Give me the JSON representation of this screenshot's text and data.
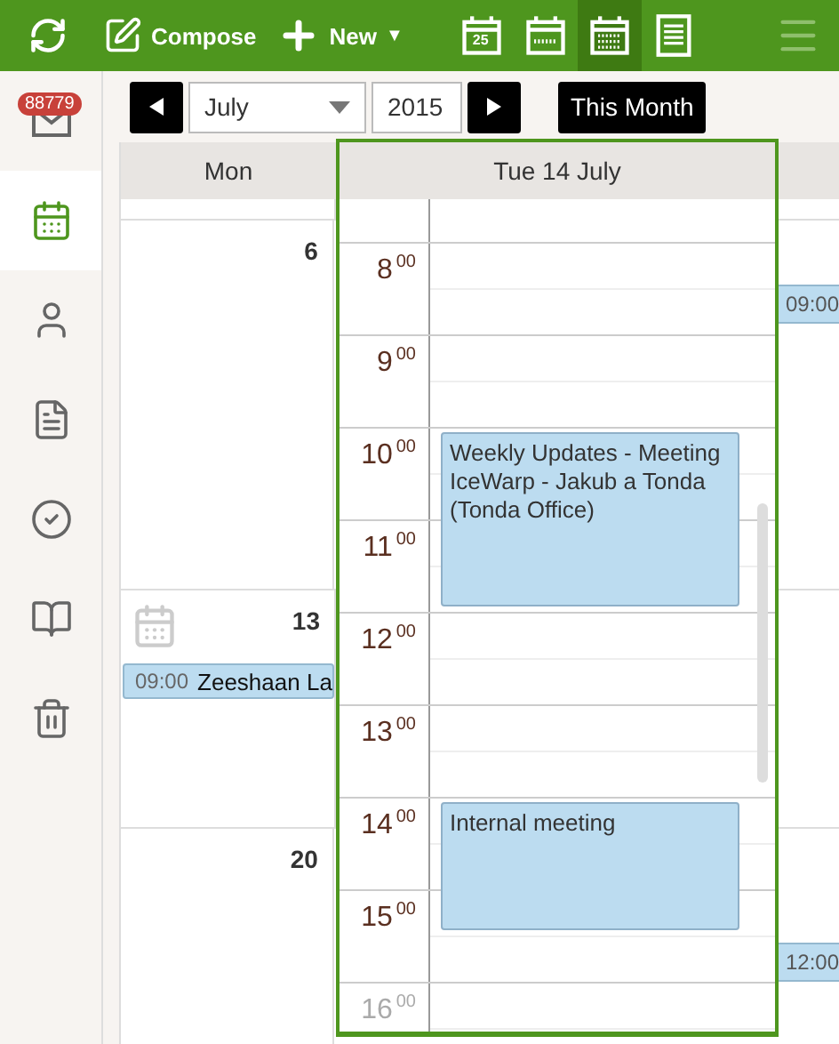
{
  "toolbar": {
    "compose": "Compose",
    "new": "New",
    "caret": "▼",
    "views": [
      {
        "kind": "day",
        "label": "25",
        "selected": false
      },
      {
        "kind": "week",
        "selected": false
      },
      {
        "kind": "month",
        "selected": true
      },
      {
        "kind": "list",
        "selected": false
      }
    ]
  },
  "sidebar": {
    "items": [
      {
        "kind": "mail",
        "badge": "88779",
        "selected": false
      },
      {
        "kind": "calendar",
        "selected": true
      },
      {
        "kind": "contacts",
        "selected": false
      },
      {
        "kind": "notes",
        "selected": false
      },
      {
        "kind": "tasks",
        "selected": false
      },
      {
        "kind": "journal",
        "selected": false
      },
      {
        "kind": "trash",
        "selected": false
      }
    ]
  },
  "navigation": {
    "month": "July",
    "year": "2015",
    "today": "This Month"
  },
  "month_grid": {
    "column": "Mon",
    "weeks": [
      {
        "date": "6",
        "side_events": [
          {
            "time": "09:00"
          }
        ]
      },
      {
        "date": "13",
        "today_icon": true,
        "events": [
          {
            "time": "09:00",
            "title": "Zeeshaan La"
          }
        ]
      },
      {
        "date": "20",
        "side_events": [
          {
            "time": "12:00"
          }
        ]
      }
    ]
  },
  "day_popup": {
    "title": "Tue 14 July",
    "hours": [
      {
        "hour": "8",
        "minutes": "00",
        "dimmed": false
      },
      {
        "hour": "9",
        "minutes": "00",
        "dimmed": false
      },
      {
        "hour": "10",
        "minutes": "00",
        "dimmed": false,
        "events": [
          {
            "kind": "long",
            "title": "Weekly Updates - Meeting IceWarp - Jakub a Tonda (Tonda Office)"
          }
        ]
      },
      {
        "hour": "11",
        "minutes": "00",
        "dimmed": false
      },
      {
        "hour": "12",
        "minutes": "00",
        "dimmed": false
      },
      {
        "hour": "13",
        "minutes": "00",
        "dimmed": false
      },
      {
        "hour": "14",
        "minutes": "00",
        "dimmed": false,
        "events": [
          {
            "kind": "medium",
            "title": "Internal meeting"
          }
        ]
      },
      {
        "hour": "15",
        "minutes": "00",
        "dimmed": false
      },
      {
        "hour": "16",
        "minutes": "00",
        "dimmed": true
      }
    ]
  }
}
